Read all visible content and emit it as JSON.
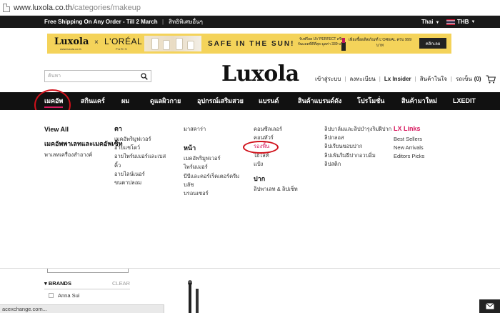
{
  "browser": {
    "url_host": "www.luxola.co.th",
    "url_path": "/categories/makeup"
  },
  "topbar": {
    "shipping": "Free Shipping On Any Order - Till 2 March",
    "separator": "|",
    "privilege": "สิทธิพิเศษอื่นๆ",
    "country": "Thai",
    "currency": "THB"
  },
  "banner": {
    "brand": "Luxola",
    "brand_sub": "www.luxola.co.th",
    "times": "×",
    "partner": "L'ORÉAL",
    "partner_sub": "PARIS",
    "headline": "SAFE IN THE SUN!",
    "promo_uv": "รับฟรีลด UV PERFECT ครีมกันแดดที่ดีที่สุด มูลค่า 339 บาท",
    "promo_gift": "เพียงซื้อผลิตภัณฑ์ L'OREAL ครบ 999 บาท",
    "cta": "คลิกเลย"
  },
  "header": {
    "search_placeholder": "ค้นหา",
    "logo": "Luxola",
    "login": "เข้าสู่ระบบ",
    "register": "ลงทะเบียน",
    "lx_insider": "Lx Insider",
    "wishlist": "สินค้าในใจ",
    "cart_label": "รถเข็น",
    "cart_count": "(0)"
  },
  "nav": {
    "items": [
      "เมคอัพ",
      "สกินแคร์",
      "ผม",
      "ดูแลผิวกาย",
      "อุปกรณ์เสริมสวย",
      "แบรนด์",
      "สินค้าแบรนด์ดัง",
      "โปรโมชั่น",
      "สินค้ามาใหม่",
      "LXEDIT"
    ],
    "accent_color": "#d81b60"
  },
  "mega_menu": {
    "col1": {
      "view_all": "View All",
      "subhead": "เมคอัพพาเลทและเมคอัพเซ็ท",
      "links": [
        "พาเลทเครื่องสำอางค์"
      ]
    },
    "col2": {
      "heading": "ตา",
      "links": [
        "เมคอัพริมูฟเวอร์",
        "อายแชโดว์",
        "อายไพร์มเมอร์และเบส",
        "คิ้ว",
        "อายไลน์เนอร์",
        "ขนตาปลอม"
      ]
    },
    "col3": {
      "links": [
        "มาสคาร่า"
      ],
      "heading": "หน้า",
      "links2": [
        "เมคอัพริมูฟเวอร์",
        "ไพร์มเมอร์",
        "บีบีและคอร์เร็คเตอร์ครีม",
        "บลัช",
        "บรอนเซอร์"
      ]
    },
    "col4": {
      "links": [
        "คอนซีลเลอร์",
        "คอนทัวร์",
        "รองพื้น",
        "ไฮไลท์",
        "แป้ง"
      ],
      "heading": "ปาก",
      "links2": [
        "ลิปพาเลท & ลิปเซ็ท"
      ]
    },
    "col5": {
      "links": [
        "ลิปบาล์มและลิปบำรุงริมฝีปาก",
        "ลิปกลอส",
        "ลิปเรียนขอบปาก",
        "ลิปเพ้นริมฝีปากอวบอิ่ม",
        "ลิปสติก"
      ]
    },
    "col6": {
      "heading": "LX Links",
      "links": [
        "Best Sellers",
        "New Arrivals",
        "Editors Picks"
      ]
    }
  },
  "filters": {
    "brands_title": "BRANDS",
    "clear": "CLEAR",
    "first_brand": "Anna Sui"
  },
  "status_bar": "acexchange.com..."
}
